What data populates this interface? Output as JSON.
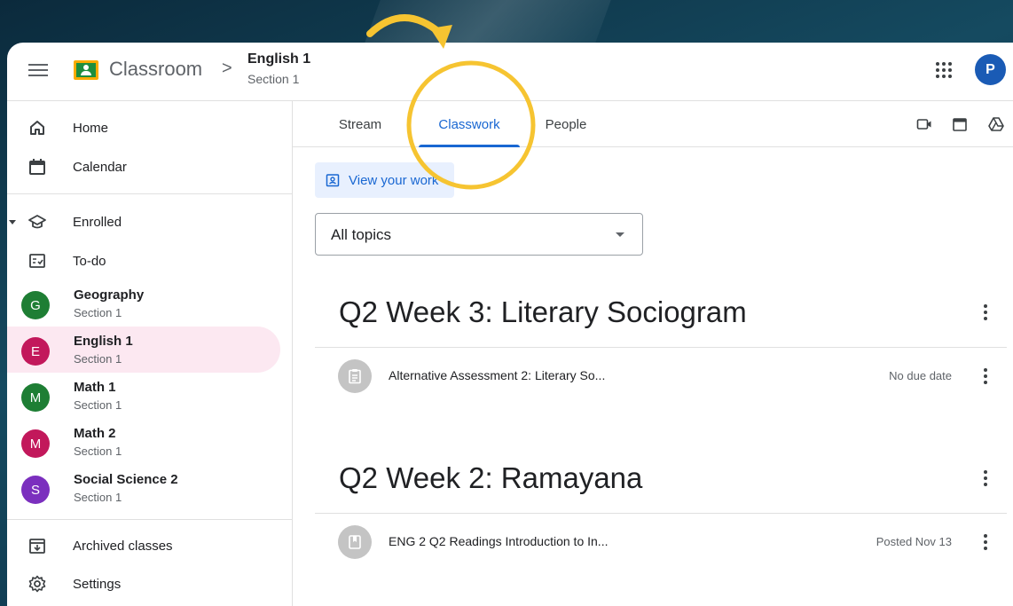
{
  "header": {
    "app_title": "Classroom",
    "separator": ">",
    "course_title": "English 1",
    "course_section": "Section 1",
    "avatar_letter": "P",
    "avatar_color": "#1a5bb5"
  },
  "sidebar": {
    "home": "Home",
    "calendar": "Calendar",
    "enrolled": "Enrolled",
    "todo": "To-do",
    "classes": [
      {
        "letter": "G",
        "name": "Geography",
        "section": "Section 1",
        "color": "#1e7e34"
      },
      {
        "letter": "E",
        "name": "English 1",
        "section": "Section 1",
        "color": "#c2185b"
      },
      {
        "letter": "M",
        "name": "Math 1",
        "section": "Section 1",
        "color": "#1e7e34"
      },
      {
        "letter": "M",
        "name": "Math 2",
        "section": "Section 1",
        "color": "#c2185b"
      },
      {
        "letter": "S",
        "name": "Social Science 2",
        "section": "Section 1",
        "color": "#7b2fbe"
      }
    ],
    "archived": "Archived classes",
    "settings": "Settings"
  },
  "tabs": {
    "stream": "Stream",
    "classwork": "Classwork",
    "people": "People"
  },
  "classwork": {
    "view_work": "View your work",
    "topic_filter": "All topics",
    "topics": [
      {
        "title": "Q2 Week 3: Literary Sociogram",
        "item_title": "Alternative Assessment 2: Literary So...",
        "item_meta": "No due date"
      },
      {
        "title": "Q2 Week 2: Ramayana",
        "item_title": "ENG 2 Q2 Readings Introduction to In...",
        "item_meta": "Posted Nov 13"
      }
    ]
  },
  "annotation_color": "#f6c431"
}
